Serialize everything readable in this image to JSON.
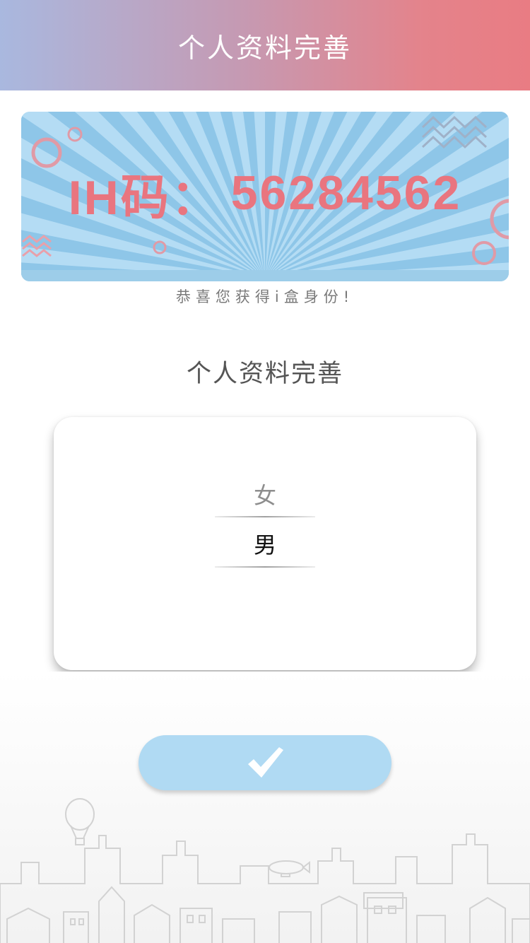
{
  "header": {
    "title": "个人资料完善"
  },
  "banner": {
    "code_label": "IH码：",
    "code_value": "56284562"
  },
  "congrats": "恭喜您获得i盒身份!",
  "section": {
    "title": "个人资料完善"
  },
  "gender_picker": {
    "options": [
      "女",
      "男"
    ],
    "selected": "男"
  },
  "confirm_button": {
    "icon": "check-icon"
  },
  "colors": {
    "header_gradient": [
      "#a9b8df",
      "#e97c83"
    ],
    "banner_bg": "#b4dcf4",
    "banner_rays": "#8ec6e8",
    "code_text": "#e9757f",
    "button_bg": "#b0daf3"
  }
}
